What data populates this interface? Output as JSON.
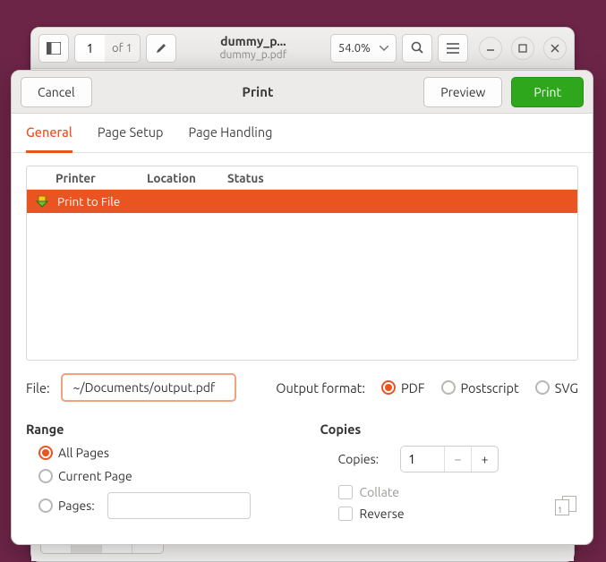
{
  "viewer": {
    "page_current": "1",
    "page_of": "of 1",
    "title_short": "dummy_p...",
    "title_sub": "dummy_p.pdf",
    "zoom": "54.0%"
  },
  "dialog": {
    "cancel": "Cancel",
    "title": "Print",
    "preview": "Preview",
    "print": "Print",
    "tabs": {
      "general": "General",
      "page_setup": "Page Setup",
      "page_handling": "Page Handling"
    },
    "table": {
      "col_printer": "Printer",
      "col_location": "Location",
      "col_status": "Status",
      "row0": "Print to File"
    },
    "file_label": "File:",
    "file_value": "~/Documents/output.pdf",
    "outfmt_label": "Output format:",
    "fmt_pdf": "PDF",
    "fmt_ps": "Postscript",
    "fmt_svg": "SVG",
    "range": {
      "heading": "Range",
      "all": "All Pages",
      "current": "Current Page",
      "pages": "Pages:"
    },
    "copies": {
      "heading": "Copies",
      "label": "Copies:",
      "value": "1",
      "collate": "Collate",
      "reverse": "Reverse"
    }
  }
}
